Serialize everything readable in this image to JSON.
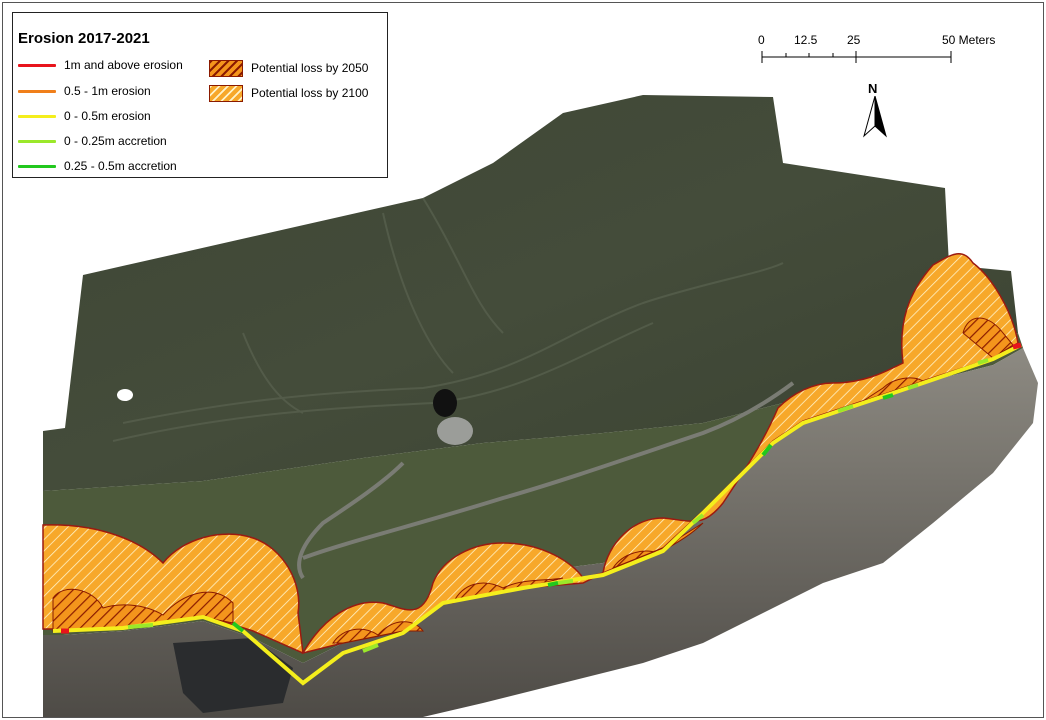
{
  "legend": {
    "title": "Erosion 2017-2021",
    "line_items": [
      {
        "label": "1m and above erosion",
        "color": "#e8141c"
      },
      {
        "label": "0.5 - 1m erosion",
        "color": "#f07f1a"
      },
      {
        "label": "0 - 0.5m erosion",
        "color": "#f4ee1c"
      },
      {
        "label": "0 - 0.25m accretion",
        "color": "#9be82a"
      },
      {
        "label": "0.25 - 0.5m accretion",
        "color": "#22c81e"
      }
    ],
    "patch_items": [
      {
        "label": "Potential loss by 2050",
        "fill": "#f59a1e",
        "hatch": "#8a1a00"
      },
      {
        "label": "Potential loss by 2100",
        "fill": "#f7b431",
        "hatch": "#ffffff"
      }
    ]
  },
  "scale_bar": {
    "labels": [
      "0",
      "12.5",
      "25",
      "50 Meters"
    ]
  },
  "north_arrow": {
    "label": "N"
  },
  "colors": {
    "field": "#3a4434",
    "grass": "#4b5a3a",
    "rock": "#6e6a62",
    "sea": "#2a2c2e",
    "loss_fill": "#f59a1e",
    "loss_outline": "#9c1a10"
  }
}
